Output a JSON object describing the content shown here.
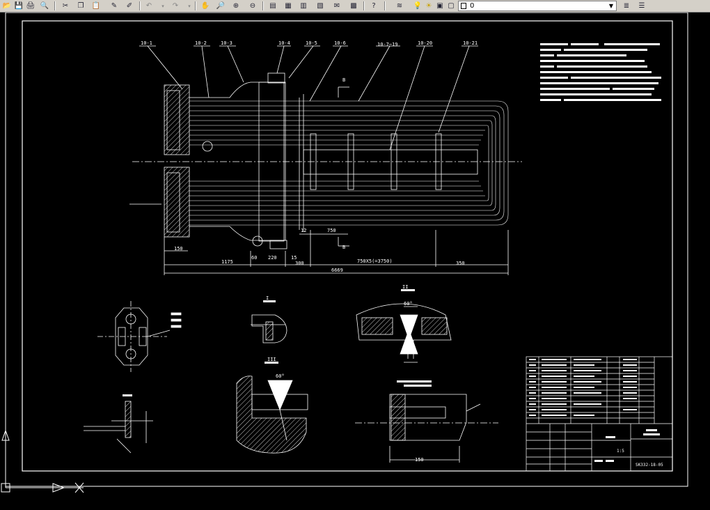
{
  "toolbar": {
    "layer_value": "0",
    "buttons": [
      "open-file",
      "save-file",
      "plot",
      "plot-preview",
      "cut",
      "copy",
      "paste",
      "match-properties",
      "undo",
      "redo",
      "pan",
      "zoom-realtime",
      "zoom-window",
      "zoom-previous",
      "properties",
      "design-center",
      "tool-palettes",
      "sheet-set",
      "markup",
      "calculator",
      "help",
      "layer-properties",
      "layer-state",
      "layers-previous"
    ]
  },
  "drawing": {
    "part_labels": [
      "10-1",
      "10-2",
      "10-3",
      "10-4",
      "10-5",
      "10-6",
      "10-7~19",
      "10-20",
      "10-21"
    ],
    "dims": {
      "d1175": "1175",
      "d60": "60",
      "d220": "220",
      "d15": "15",
      "d300": "300",
      "d150": "150",
      "d750x5": "750X5(=3750)",
      "d350": "350",
      "d6669": "6669",
      "d12": "12",
      "d750": "750",
      "d150b": "150"
    },
    "section_label": "B",
    "detail_labels": [
      "I",
      "II",
      "III"
    ],
    "weld_angle": "60°",
    "title_block": {
      "drawing_no": "SK332-18-05",
      "scale": "1:5"
    }
  },
  "colors": {
    "background": "#000000",
    "lines": "#ffffff",
    "toolbar": "#d4d0c8"
  }
}
